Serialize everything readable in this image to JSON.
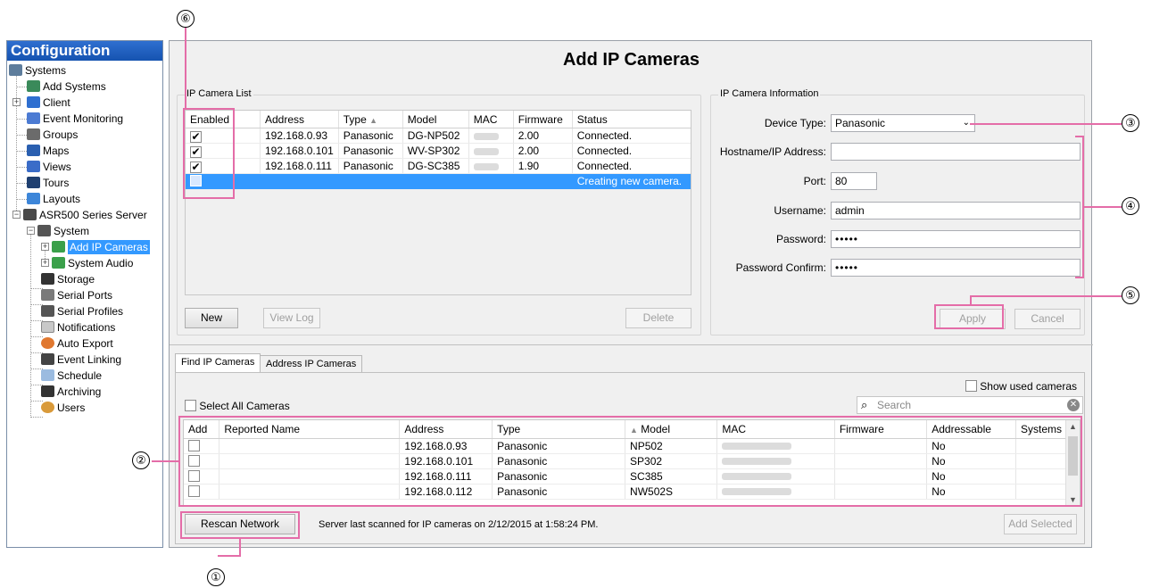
{
  "sidebar": {
    "title": "Configuration",
    "items": [
      {
        "label": "Systems",
        "icon": "systems-icon"
      },
      {
        "label": "Add Systems",
        "icon": "add-systems-icon"
      },
      {
        "label": "Client",
        "icon": "client-icon"
      },
      {
        "label": "Event Monitoring",
        "icon": "event-monitoring-icon"
      },
      {
        "label": "Groups",
        "icon": "groups-icon"
      },
      {
        "label": "Maps",
        "icon": "maps-icon"
      },
      {
        "label": "Views",
        "icon": "views-icon"
      },
      {
        "label": "Tours",
        "icon": "tours-icon"
      },
      {
        "label": "Layouts",
        "icon": "layouts-icon"
      },
      {
        "label": "ASR500 Series Server",
        "icon": "server-icon"
      },
      {
        "label": "System",
        "icon": "system-icon"
      },
      {
        "label": "Add IP Cameras",
        "icon": "ip-camera-icon"
      },
      {
        "label": "System Audio",
        "icon": "audio-icon"
      },
      {
        "label": "Storage",
        "icon": "storage-icon"
      },
      {
        "label": "Serial Ports",
        "icon": "serial-ports-icon"
      },
      {
        "label": "Serial Profiles",
        "icon": "serial-profiles-icon"
      },
      {
        "label": "Notifications",
        "icon": "notifications-icon"
      },
      {
        "label": "Auto Export",
        "icon": "auto-export-icon"
      },
      {
        "label": "Event Linking",
        "icon": "event-linking-icon"
      },
      {
        "label": "Schedule",
        "icon": "schedule-icon"
      },
      {
        "label": "Archiving",
        "icon": "archiving-icon"
      },
      {
        "label": "Users",
        "icon": "users-icon"
      }
    ],
    "selected": "Add IP Cameras"
  },
  "main": {
    "title": "Add IP Cameras",
    "camera_list": {
      "group_title": "IP Camera List",
      "headers": [
        "Enabled",
        "Address",
        "Type",
        "Model",
        "MAC",
        "Firmware",
        "Status"
      ],
      "rows": [
        {
          "enabled": "✔",
          "address": "192.168.0.93",
          "type": "Panasonic",
          "model": "DG-NP502",
          "firmware": "2.00",
          "status": "Connected."
        },
        {
          "enabled": "✔",
          "address": "192.168.0.101",
          "type": "Panasonic",
          "model": "WV-SP302",
          "firmware": "2.00",
          "status": "Connected."
        },
        {
          "enabled": "✔",
          "address": "192.168.0.111",
          "type": "Panasonic",
          "model": "DG-SC385",
          "firmware": "1.90",
          "status": "Connected."
        },
        {
          "enabled": "",
          "address": "",
          "type": "",
          "model": "",
          "firmware": "",
          "status": "Creating new camera."
        }
      ],
      "buttons": {
        "new": "New",
        "view_log": "View Log",
        "delete": "Delete"
      }
    },
    "camera_info": {
      "group_title": "IP Camera Information",
      "device_type_label": "Device Type:",
      "device_type_value": "Panasonic",
      "hostname_label": "Hostname/IP Address:",
      "hostname_value": "",
      "port_label": "Port:",
      "port_value": "80",
      "username_label": "Username:",
      "username_value": "admin",
      "password_label": "Password:",
      "password_value": "•••••",
      "password_confirm_label": "Password Confirm:",
      "password_confirm_value": "•••••",
      "buttons": {
        "apply": "Apply",
        "cancel": "Cancel"
      }
    },
    "find": {
      "tabs": [
        "Find IP Cameras",
        "Address IP Cameras"
      ],
      "show_used_label": "Show used cameras",
      "select_all_label": "Select All Cameras",
      "search_placeholder": "Search",
      "headers": [
        "Add",
        "Reported Name",
        "Address",
        "Type",
        "Model",
        "MAC",
        "Firmware",
        "Addressable",
        "Systems"
      ],
      "rows": [
        {
          "address": "192.168.0.93",
          "type": "Panasonic",
          "model": "NP502",
          "addressable": "No"
        },
        {
          "address": "192.168.0.101",
          "type": "Panasonic",
          "model": "SP302",
          "addressable": "No"
        },
        {
          "address": "192.168.0.111",
          "type": "Panasonic",
          "model": "SC385",
          "addressable": "No"
        },
        {
          "address": "192.168.0.112",
          "type": "Panasonic",
          "model": "NW502S",
          "addressable": "No"
        }
      ],
      "rescan_label": "Rescan Network",
      "scan_status": "Server last scanned for IP cameras on 2/12/2015 at 1:58:24 PM.",
      "add_selected_label": "Add Selected"
    }
  },
  "callouts": [
    "①",
    "②",
    "③",
    "④",
    "⑤",
    "⑥"
  ],
  "colors": {
    "highlight": "#e46da8",
    "selection": "#3399ff",
    "title_bar": "#1553b0"
  }
}
